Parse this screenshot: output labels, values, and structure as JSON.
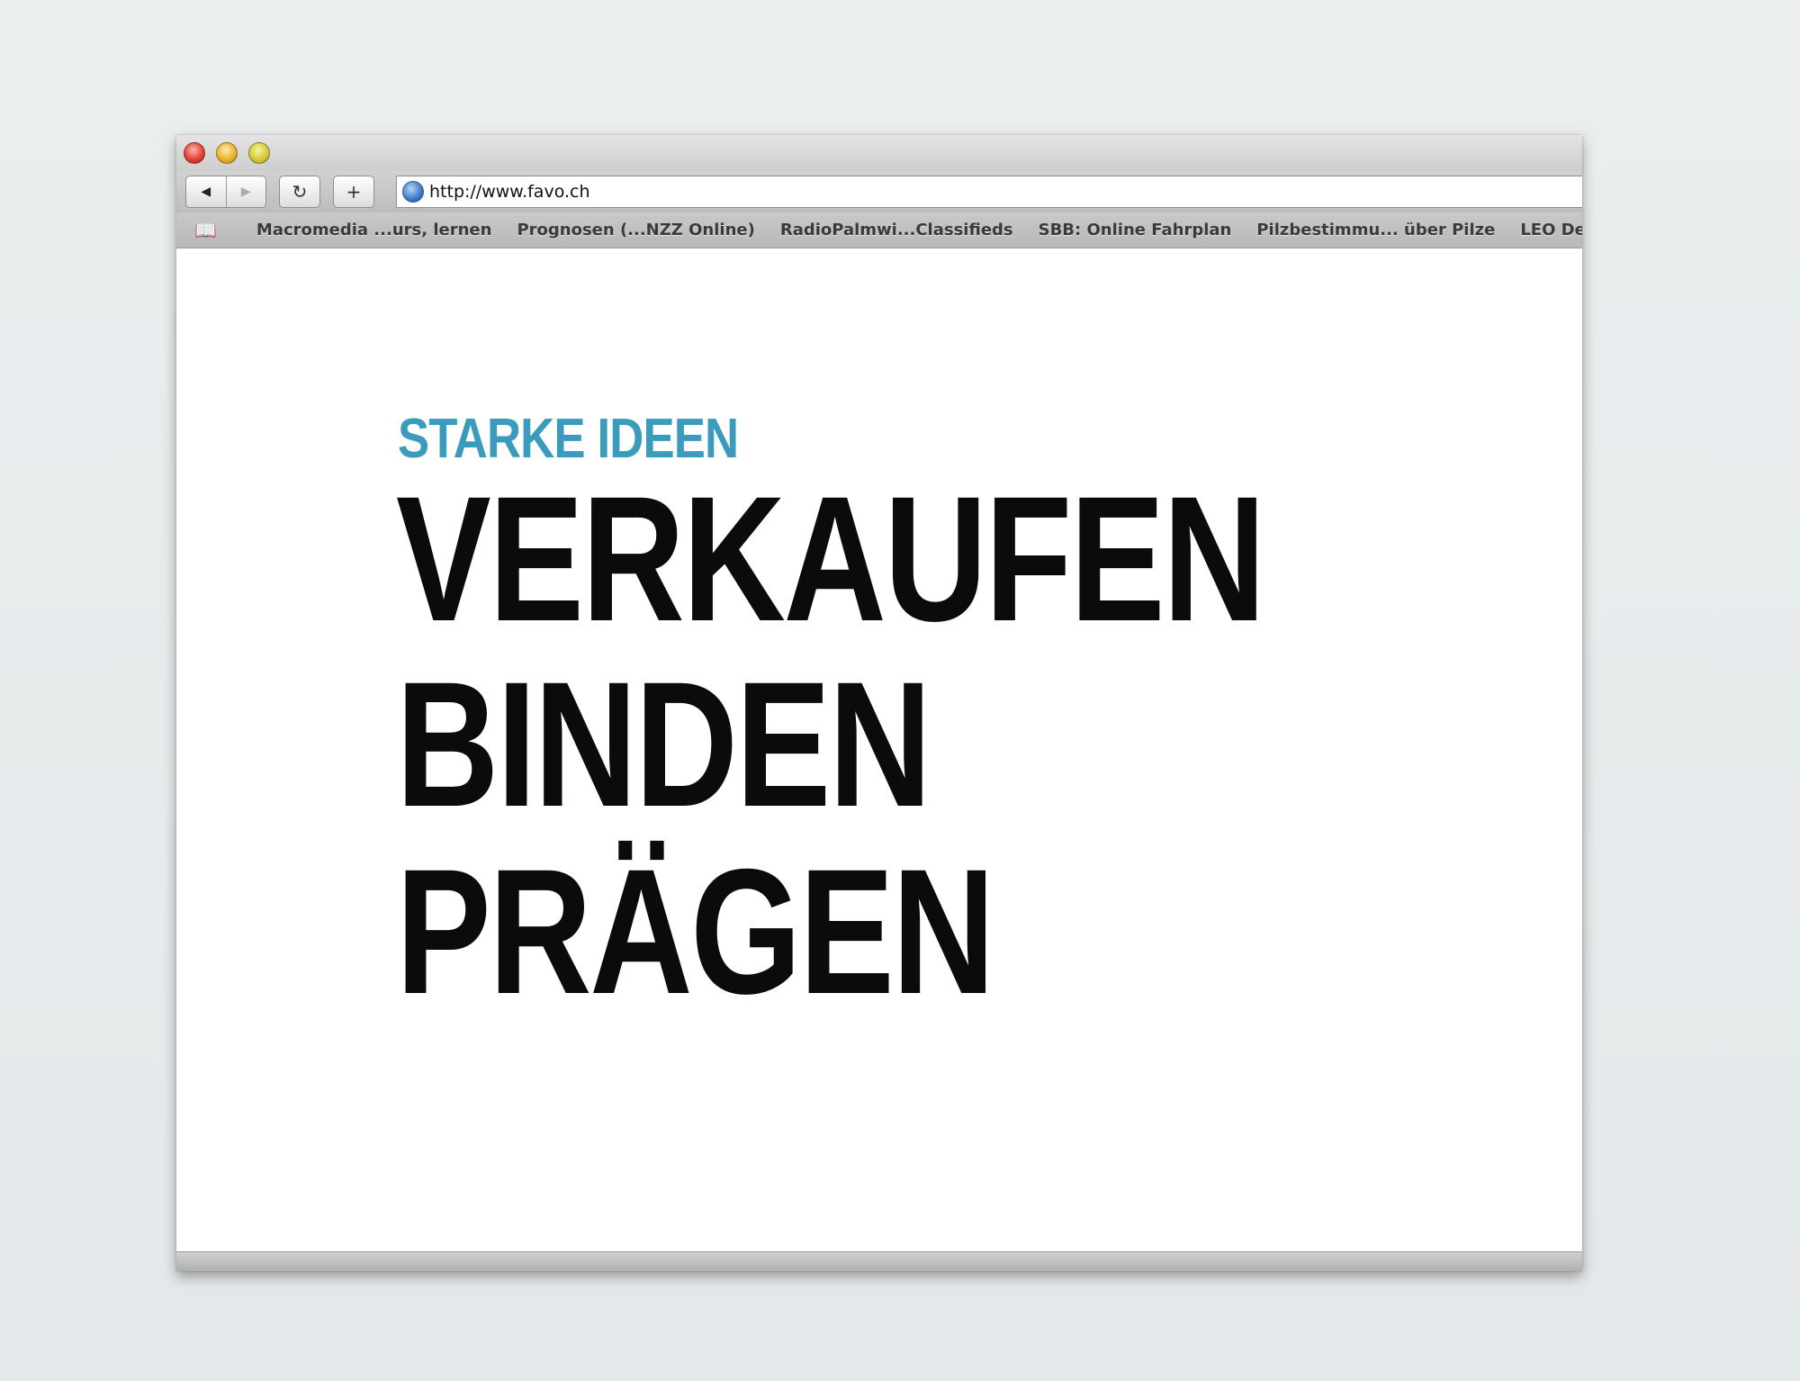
{
  "browser": {
    "window_buttons": {
      "close": "×",
      "minimize": "−",
      "zoom": "+"
    },
    "toolbar": {
      "back_icon": "◀",
      "forward_icon": "▶",
      "reload_icon": "↻",
      "add_icon": "+"
    },
    "address": {
      "url": "http://www.favo.ch"
    },
    "bookmarks": [
      "Macromedia ...urs, lernen",
      "Prognosen (...NZZ Online)",
      "RadioPalmwi...Classifieds",
      "SBB: Online Fahrplan",
      "Pilzbestimmu... über Pilze",
      "LEO Deu"
    ]
  },
  "page": {
    "kicker": "STARKE IDEEN",
    "headlines": [
      "VERKAUFEN",
      "BINDEN",
      "PRÄGEN"
    ]
  },
  "colors": {
    "accent": "#3a9bbd",
    "headline": "#0b0b0b"
  },
  "icons": {
    "bookmarks_icon": "📖"
  }
}
